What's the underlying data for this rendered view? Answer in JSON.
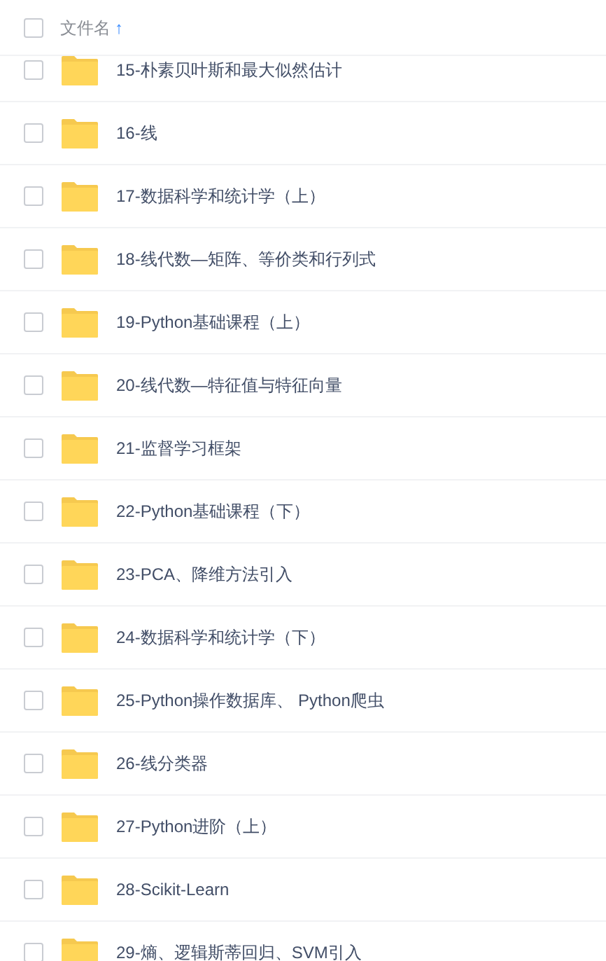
{
  "header": {
    "checked": false,
    "column": "文件名",
    "sort_arrow": "↑"
  },
  "rows": [
    {
      "name": "15-朴素贝叶斯和最大似然估计",
      "checked": false
    },
    {
      "name": "16-线",
      "checked": false
    },
    {
      "name": "17-数据科学和统计学（上）",
      "checked": false
    },
    {
      "name": "18-线代数—矩阵、等价类和行列式",
      "checked": false
    },
    {
      "name": "19-Python基础课程（上）",
      "checked": false
    },
    {
      "name": "20-线代数—特征值与特征向量",
      "checked": false
    },
    {
      "name": "21-监督学习框架",
      "checked": false
    },
    {
      "name": "22-Python基础课程（下）",
      "checked": false
    },
    {
      "name": "23-PCA、降维方法引入",
      "checked": false
    },
    {
      "name": "24-数据科学和统计学（下）",
      "checked": false
    },
    {
      "name": "25-Python操作数据库、 Python爬虫",
      "checked": false
    },
    {
      "name": "26-线分类器",
      "checked": false
    },
    {
      "name": "27-Python进阶（上）",
      "checked": false
    },
    {
      "name": "28-Scikit-Learn",
      "checked": false
    },
    {
      "name": "29-熵、逻辑斯蒂回归、SVM引入",
      "checked": false
    }
  ]
}
